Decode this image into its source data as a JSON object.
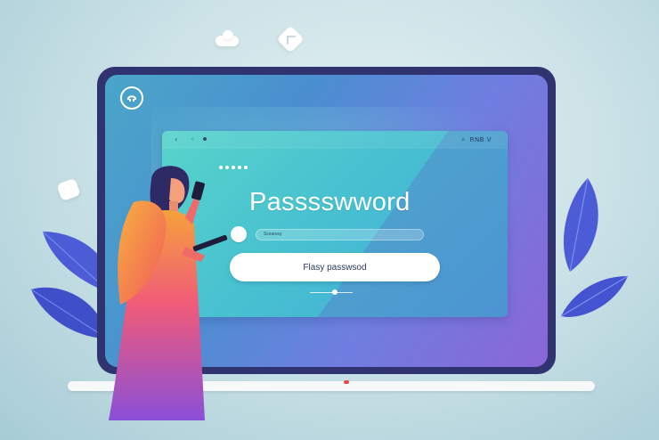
{
  "browser": {
    "status_text": "RNB V"
  },
  "login": {
    "title": "Passsswword",
    "input_value": "Ssswssy",
    "button_label": "Flasy passwsod"
  },
  "colors": {
    "screen_bezel": "#2f3470",
    "browser_panel": "#52c6cf",
    "button_bg": "#ffffff",
    "leaf": "#4a5ad8",
    "figure_dress_top": "#f28a3a",
    "figure_dress_bottom": "#8a4fd8",
    "figure_hair": "#2e2a66"
  },
  "icons": {
    "logo": "headset-circle-icon",
    "chip_1": "cloud-icon",
    "chip_2": "diamond-icon",
    "chip_3": "chat-bubble-icon",
    "browser_back": "chevron-left-icon",
    "browser_search": "search-icon"
  }
}
